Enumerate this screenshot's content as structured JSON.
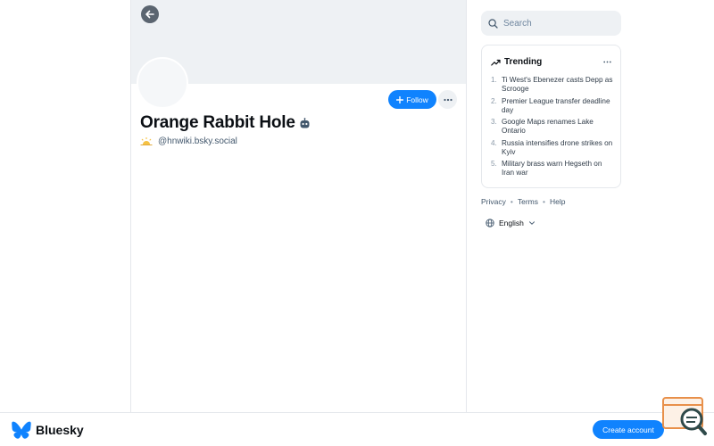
{
  "profile": {
    "display_name": "Orange Rabbit Hole",
    "handle": "@hnwiki.bsky.social",
    "follow_label": "Follow"
  },
  "search": {
    "placeholder": "Search"
  },
  "trending": {
    "title": "Trending",
    "items": [
      {
        "num": "1.",
        "text": "Ti West's Ebenezer casts Depp as Scrooge"
      },
      {
        "num": "2.",
        "text": "Premier League transfer deadline day"
      },
      {
        "num": "3.",
        "text": "Google Maps renames Lake Ontario"
      },
      {
        "num": "4.",
        "text": "Russia intensifies drone strikes on Kyiv"
      },
      {
        "num": "5.",
        "text": "Military brass warn Hegseth on Iran war"
      }
    ]
  },
  "footer": {
    "privacy": "Privacy",
    "terms": "Terms",
    "help": "Help",
    "separator": "•"
  },
  "language": {
    "selected": "English"
  },
  "bottombar": {
    "brand": "Bluesky",
    "create_account": "Create account"
  },
  "colors": {
    "accent": "#1083fe",
    "banner": "#eef1f4",
    "border": "#e5e8ec",
    "muted_text": "#42576c"
  },
  "icons": [
    "back-arrow-icon",
    "plus-icon",
    "ellipsis-icon",
    "bot-icon",
    "sunrise-icon",
    "search-icon",
    "trending-up-icon",
    "globe-icon",
    "chevron-down-icon",
    "butterfly-logo-icon"
  ]
}
